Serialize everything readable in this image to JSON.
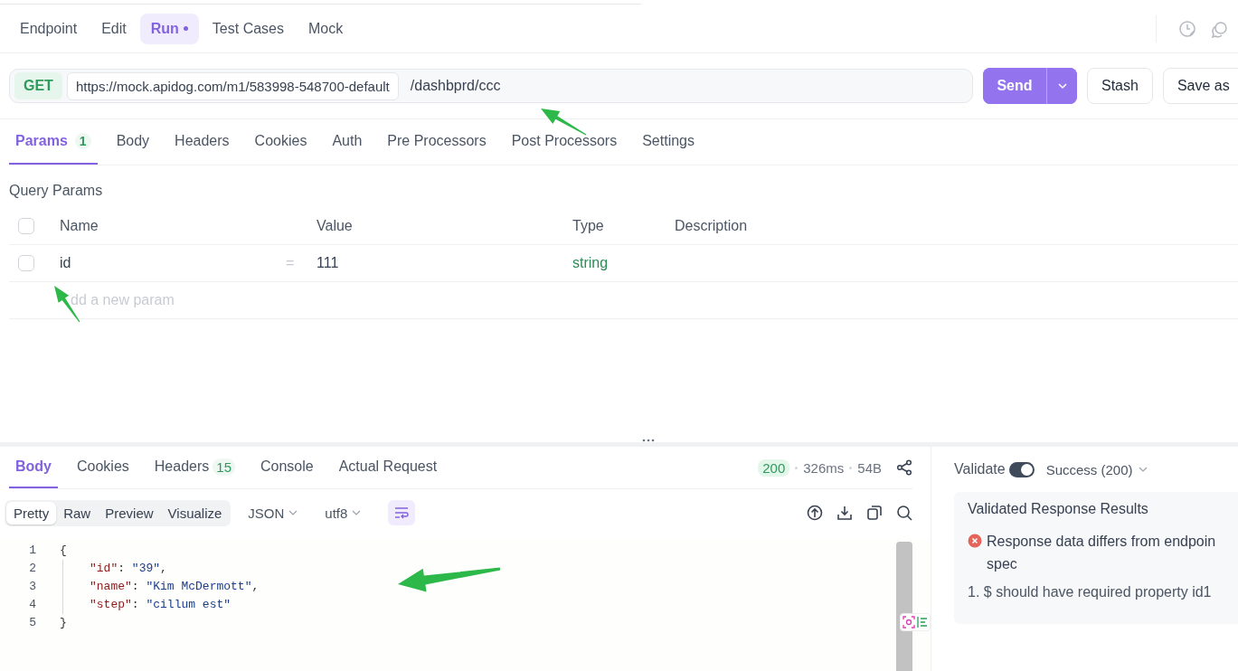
{
  "mode_tabs": [
    {
      "label": "Endpoint",
      "selected": false,
      "dot": false
    },
    {
      "label": "Edit",
      "selected": false,
      "dot": false
    },
    {
      "label": "Run",
      "selected": true,
      "dot": true
    },
    {
      "label": "Test Cases",
      "selected": false,
      "dot": false
    },
    {
      "label": "Mock",
      "selected": false,
      "dot": false
    }
  ],
  "request": {
    "method": "GET",
    "base_url": "https://mock.apidog.com/m1/583998-548700-default",
    "path": "/dashbprd/ccc",
    "send_label": "Send",
    "buttons": [
      "Stash",
      "Save as"
    ]
  },
  "request_tabs": [
    {
      "label": "Params",
      "badge": "1",
      "selected": true
    },
    {
      "label": "Body",
      "selected": false
    },
    {
      "label": "Headers",
      "selected": false
    },
    {
      "label": "Cookies",
      "selected": false
    },
    {
      "label": "Auth",
      "selected": false
    },
    {
      "label": "Pre Processors",
      "selected": false
    },
    {
      "label": "Post Processors",
      "selected": false
    },
    {
      "label": "Settings",
      "selected": false
    }
  ],
  "query_params": {
    "title": "Query Params",
    "select_all_checked": false,
    "columns": [
      "Name",
      "Value",
      "Type",
      "Description"
    ],
    "rows": [
      {
        "checked": false,
        "name": "id",
        "separator": "=",
        "value": "111",
        "type": "string"
      }
    ],
    "new_param_placeholder": "dd a new param"
  },
  "response": {
    "tabs": [
      {
        "label": "Body",
        "selected": true
      },
      {
        "label": "Cookies",
        "selected": false
      },
      {
        "label": "Headers",
        "badge": "15",
        "selected": false
      },
      {
        "label": "Console",
        "selected": false
      },
      {
        "label": "Actual Request",
        "selected": false
      }
    ],
    "status": "200",
    "time": "326ms",
    "size": "54B",
    "views": [
      {
        "label": "Pretty",
        "selected": true
      },
      {
        "label": "Raw",
        "selected": false
      },
      {
        "label": "Preview",
        "selected": false
      },
      {
        "label": "Visualize",
        "selected": false
      }
    ],
    "format": "JSON",
    "encoding": "utf8",
    "wrap_on": true,
    "code": {
      "line_numbers": [
        "1",
        "2",
        "3",
        "4",
        "5"
      ],
      "open": "{",
      "close": "}",
      "members": [
        {
          "key": "\"id\"",
          "colon": ":",
          "value": "\"39\"",
          "comma": ","
        },
        {
          "key": "\"name\"",
          "colon": ":",
          "value": "\"Kim McDermott\"",
          "comma": ","
        },
        {
          "key": "\"step\"",
          "colon": ":",
          "value": "\"cillum est\""
        }
      ]
    }
  },
  "validation": {
    "label": "Validate",
    "on": true,
    "response_option": "Success (200)",
    "title": "Validated Response Results",
    "error_lines": [
      "Response data differs from endpoin",
      "spec"
    ],
    "issues": [
      "1. $ should have required property id1"
    ]
  }
}
